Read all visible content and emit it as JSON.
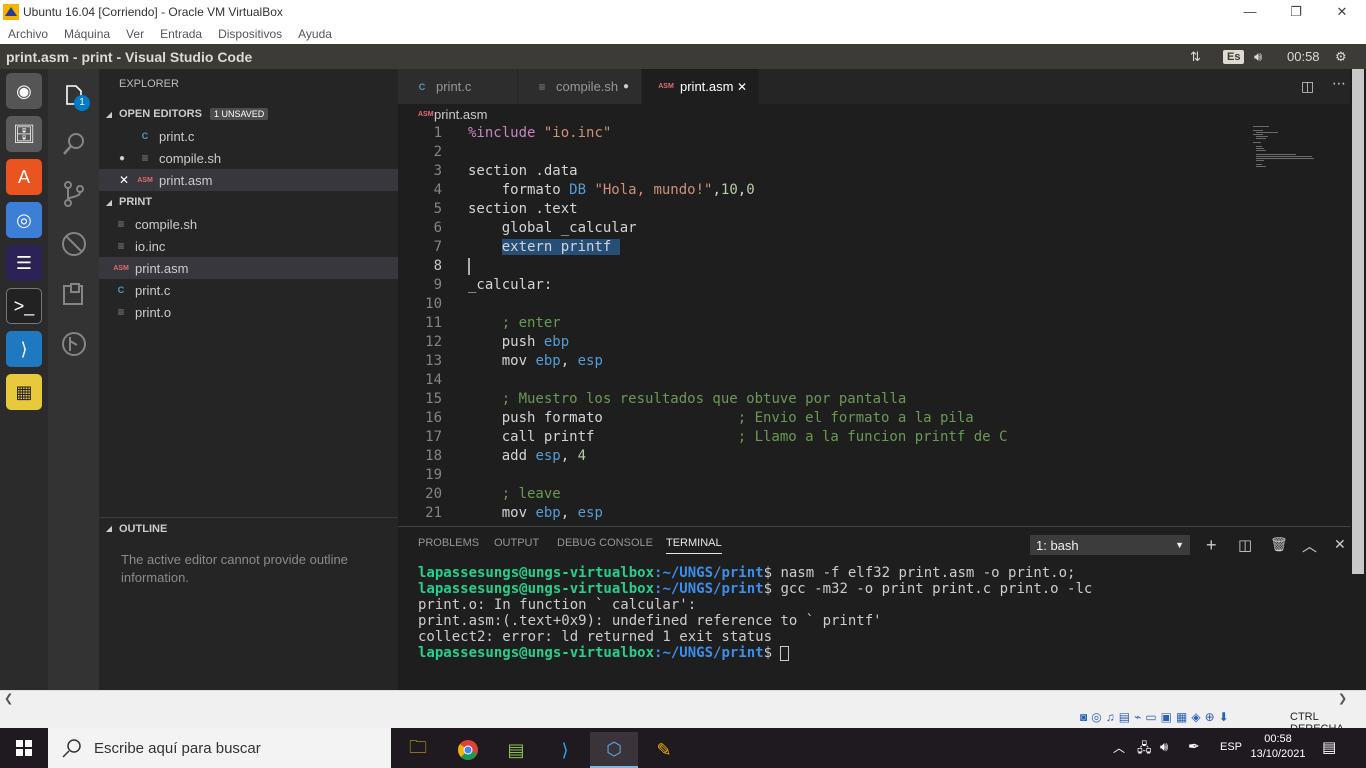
{
  "vbox": {
    "title": "Ubuntu 16.04 [Corriendo] - Oracle VM VirtualBox",
    "menu": [
      "Archivo",
      "Máquina",
      "Ver",
      "Entrada",
      "Dispositivos",
      "Ayuda"
    ],
    "status_host_key": "CTRL DERECHA"
  },
  "ubuntu": {
    "window_title": "print.asm - print - Visual Studio Code",
    "keyboard": "Es",
    "time": "00:58"
  },
  "sidebar": {
    "header": "EXPLORER",
    "open_editors": {
      "label": "OPEN EDITORS",
      "badge": "1 UNSAVED"
    },
    "open_files": [
      {
        "icon": "C",
        "name": "print.c"
      },
      {
        "icon": "≡",
        "name": "compile.sh"
      },
      {
        "icon": "ASM",
        "name": "print.asm"
      }
    ],
    "folder": "PRINT",
    "files": [
      {
        "icon": "≡",
        "name": "compile.sh"
      },
      {
        "icon": "≡",
        "name": "io.inc"
      },
      {
        "icon": "ASM",
        "name": "print.asm"
      },
      {
        "icon": "C",
        "name": "print.c"
      },
      {
        "icon": "≡",
        "name": "print.o"
      }
    ],
    "outline": {
      "label": "OUTLINE",
      "message": "The active editor cannot provide outline information."
    },
    "activity_badge": "1"
  },
  "editor": {
    "tabs": [
      {
        "icon": "C",
        "label": "print.c"
      },
      {
        "icon": "≡",
        "label": "compile.sh"
      },
      {
        "icon": "ASM",
        "label": "print.asm"
      }
    ],
    "breadcrumb_icon": "ASM",
    "breadcrumb": "print.asm",
    "line_numbers": [
      "1",
      "2",
      "3",
      "4",
      "5",
      "6",
      "7",
      "8",
      "9",
      "10",
      "11",
      "12",
      "13",
      "14",
      "15",
      "16",
      "17",
      "18",
      "19",
      "20",
      "21"
    ]
  },
  "panel": {
    "tabs": [
      "PROBLEMS",
      "OUTPUT",
      "DEBUG CONSOLE",
      "TERMINAL"
    ],
    "terminal_select": "1: bash",
    "prompt_user": "lapassesungs@ungs-virtualbox",
    "prompt_path": ":~/UNGS/print",
    "cmd1": "$ nasm -f elf32 print.asm -o print.o;",
    "cmd2": "$ gcc -m32 -o print print.c print.o -lc",
    "out1": "print.o: In function ` calcular':",
    "out2": "print.asm:(.text+0x9): undefined reference to ` printf'",
    "out3": "collect2: error: ld returned 1 exit status",
    "cmd3": "$ "
  },
  "taskbar": {
    "search_placeholder": "Escribe aquí para buscar",
    "lang": "ESP",
    "time": "00:58",
    "date": "13/10/2021"
  }
}
